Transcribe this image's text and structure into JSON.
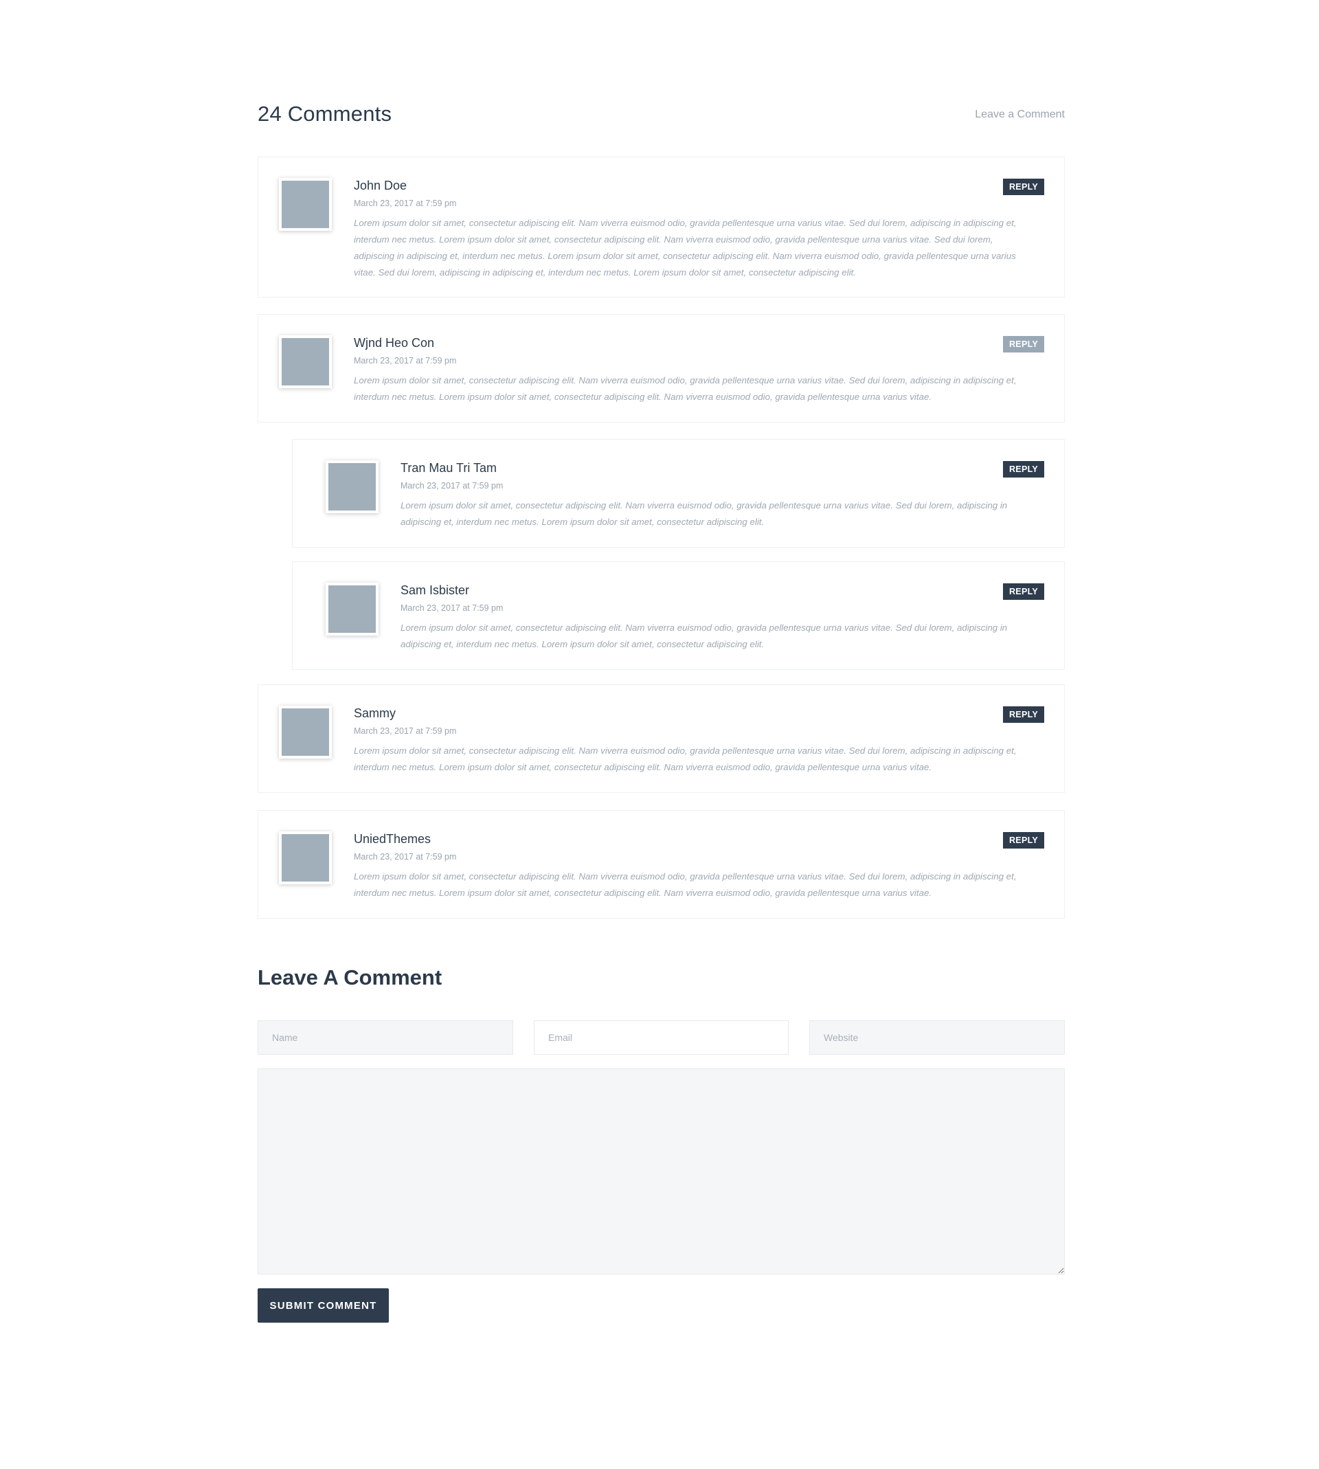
{
  "comments_section": {
    "title": "24 Comments",
    "leave_link": "Leave a Comment"
  },
  "comments": [
    {
      "name": "John Doe",
      "date": "March 23, 2017 at 7:59 pm",
      "reply_label": "REPLY",
      "lines": [
        "Lorem ipsum dolor sit amet, consectetur adipiscing elit. Nam viverra euismod odio, gravida pellentesque urna varius vitae. Sed dui lorem, adipiscing in adipiscing et,",
        "interdum nec metus. Lorem ipsum dolor sit amet, consectetur adipiscing elit. Nam viverra euismod odio, gravida pellentesque urna varius vitae. Sed dui lorem,",
        "adipiscing in adipiscing et, interdum nec metus. Lorem ipsum dolor sit amet, consectetur adipiscing elit. Nam viverra euismod odio, gravida pellentesque urna varius",
        "vitae. Sed dui lorem, adipiscing in adipiscing et, interdum nec metus. Lorem ipsum dolor sit amet, consectetur adipiscing elit."
      ]
    },
    {
      "name": "Wjnd Heo Con",
      "date": "March 23, 2017 at 7:59 pm",
      "reply_label": "REPLY",
      "lines": [
        "Lorem ipsum dolor sit amet, consectetur adipiscing elit. Nam viverra euismod odio, gravida pellentesque urna varius vitae. Sed dui lorem, adipiscing in adipiscing et,",
        "interdum nec metus. Lorem ipsum dolor sit amet, consectetur adipiscing elit. Nam viverra euismod odio, gravida pellentesque urna varius vitae."
      ]
    },
    {
      "name": "Tran Mau Tri Tam",
      "date": "March 23, 2017 at 7:59 pm",
      "reply_label": "REPLY",
      "lines": [
        "Lorem ipsum dolor sit amet, consectetur adipiscing elit. Nam viverra euismod odio, gravida pellentesque urna varius vitae. Sed dui lorem, adipiscing in",
        "adipiscing et, interdum nec metus. Lorem ipsum dolor sit amet, consectetur adipiscing elit."
      ]
    },
    {
      "name": "Sam Isbister",
      "date": "March 23, 2017 at 7:59 pm",
      "reply_label": "REPLY",
      "lines": [
        "Lorem ipsum dolor sit amet, consectetur adipiscing elit. Nam viverra euismod odio, gravida pellentesque urna varius vitae. Sed dui lorem, adipiscing in",
        "adipiscing et, interdum nec metus. Lorem ipsum dolor sit amet, consectetur adipiscing elit."
      ]
    },
    {
      "name": "Sammy",
      "date": "March 23, 2017 at 7:59 pm",
      "reply_label": "REPLY",
      "lines": [
        "Lorem ipsum dolor sit amet, consectetur adipiscing elit. Nam viverra euismod odio, gravida pellentesque urna varius vitae. Sed dui lorem, adipiscing in adipiscing et,",
        "interdum nec metus. Lorem ipsum dolor sit amet, consectetur adipiscing elit. Nam viverra euismod odio, gravida pellentesque urna varius vitae."
      ]
    },
    {
      "name": "UniedThemes",
      "date": "March 23, 2017 at 7:59 pm",
      "reply_label": "REPLY",
      "lines": [
        "Lorem ipsum dolor sit amet, consectetur adipiscing elit. Nam viverra euismod odio, gravida pellentesque urna varius vitae. Sed dui lorem, adipiscing in adipiscing et,",
        "interdum nec metus. Lorem ipsum dolor sit amet, consectetur adipiscing elit. Nam viverra euismod odio, gravida pellentesque urna varius vitae."
      ]
    }
  ],
  "form": {
    "title": "Leave A Comment",
    "name_placeholder": "Name",
    "email_placeholder": "Email",
    "website_placeholder": "Website",
    "name_value": "",
    "email_value": "",
    "website_value": "",
    "message_value": "",
    "submit_label": "SUBMIT COMMENT"
  },
  "colors": {
    "heading": "#2b3a4a",
    "muted_text": "#9ea8b2",
    "button_dark": "#2e3c4d",
    "button_muted": "#9aa8b5",
    "avatar_placeholder": "#a0afba",
    "field_bg": "#f5f6f8"
  }
}
